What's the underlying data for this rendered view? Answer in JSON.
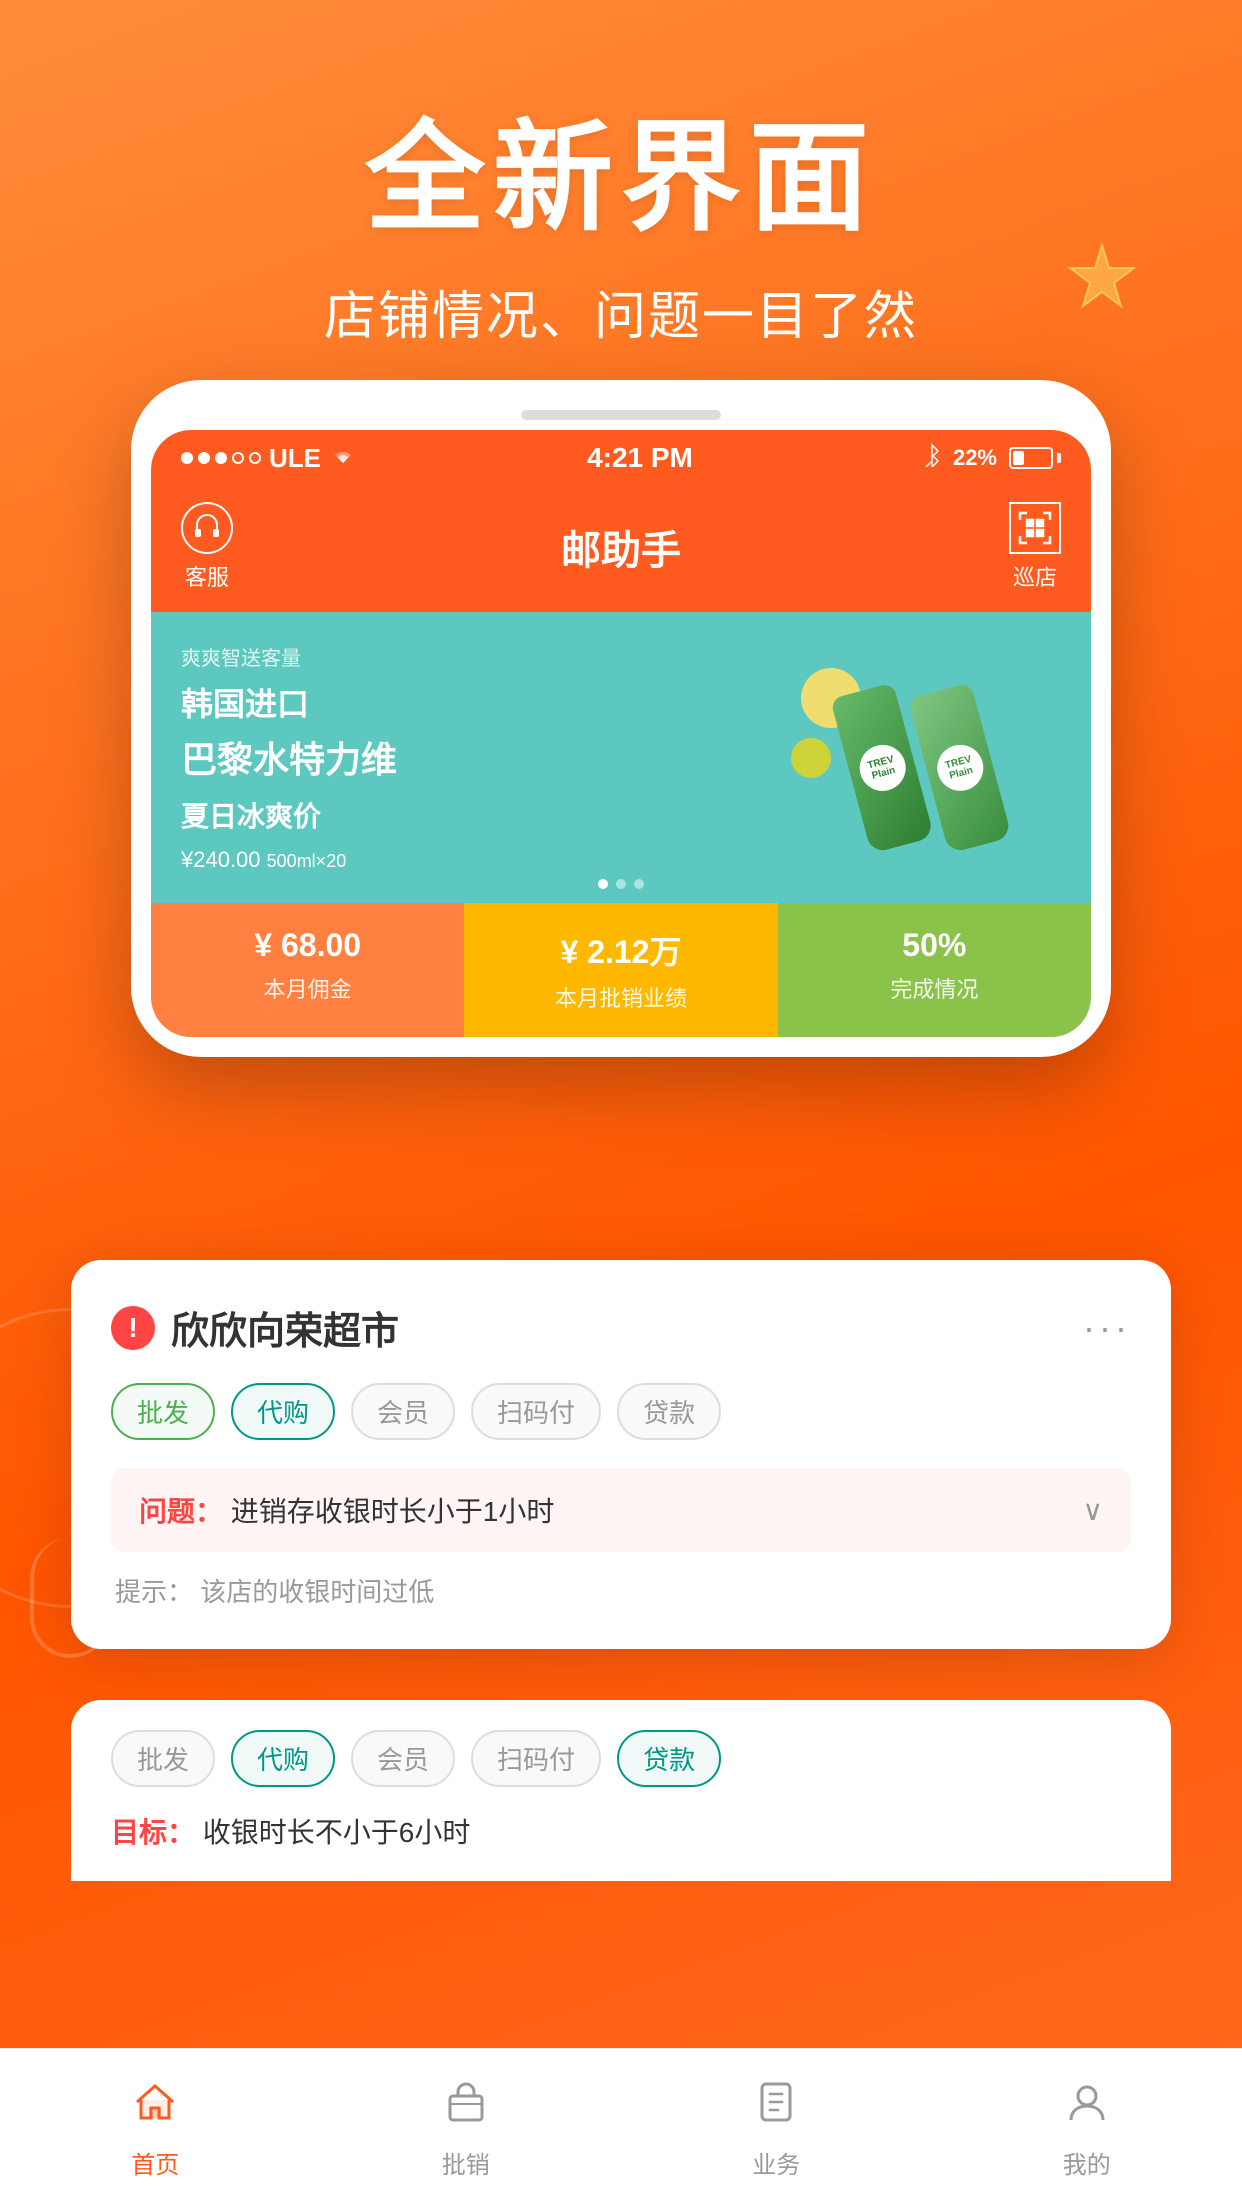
{
  "page": {
    "background_gradient_start": "#FF8C3A",
    "background_gradient_end": "#FF5500"
  },
  "header": {
    "main_title": "全新界面",
    "sub_title": "店铺情况、问题一目了然"
  },
  "status_bar": {
    "carrier": "ULE",
    "time": "4:21 PM",
    "battery_percent": "22%"
  },
  "app_nav": {
    "title": "邮助手",
    "left_label": "客服",
    "right_label": "巡店"
  },
  "banner": {
    "tag_text": "爽爽智送客量",
    "headline": "韩国进口",
    "product_name": "巴黎水特力维",
    "sub_name": "夏日冰爽价",
    "price": "¥240.00",
    "unit": "500ml×20"
  },
  "stats": [
    {
      "value": "¥ 68.00",
      "label": "本月佣金"
    },
    {
      "value": "¥ 2.12万",
      "label": "本月批销业绩"
    },
    {
      "value": "50%",
      "label": "完成情况"
    }
  ],
  "store_card": {
    "store_name": "欣欣向荣超市",
    "more_label": "···",
    "tags": [
      {
        "text": "批发",
        "style": "green"
      },
      {
        "text": "代购",
        "style": "teal"
      },
      {
        "text": "会员",
        "style": "gray"
      },
      {
        "text": "扫码付",
        "style": "gray"
      },
      {
        "text": "贷款",
        "style": "gray"
      }
    ],
    "problem_label": "问题：",
    "problem_text": "进销存收银时长小于1小时",
    "hint_prefix": "提示：",
    "hint_text": "该店的收银时间过低"
  },
  "second_card": {
    "tags": [
      {
        "text": "批发",
        "style": "gray"
      },
      {
        "text": "代购",
        "style": "teal"
      },
      {
        "text": "会员",
        "style": "gray"
      },
      {
        "text": "扫码付",
        "style": "gray"
      },
      {
        "text": "贷款",
        "style": "teal"
      }
    ],
    "target_label": "目标：",
    "target_text": "收银时长不小于6小时"
  },
  "bottom_nav": {
    "items": [
      {
        "label": "首页",
        "active": true,
        "icon": "home"
      },
      {
        "label": "批销",
        "active": false,
        "icon": "shop"
      },
      {
        "label": "业务",
        "active": false,
        "icon": "task"
      },
      {
        "label": "我的",
        "active": false,
        "icon": "user"
      }
    ]
  }
}
